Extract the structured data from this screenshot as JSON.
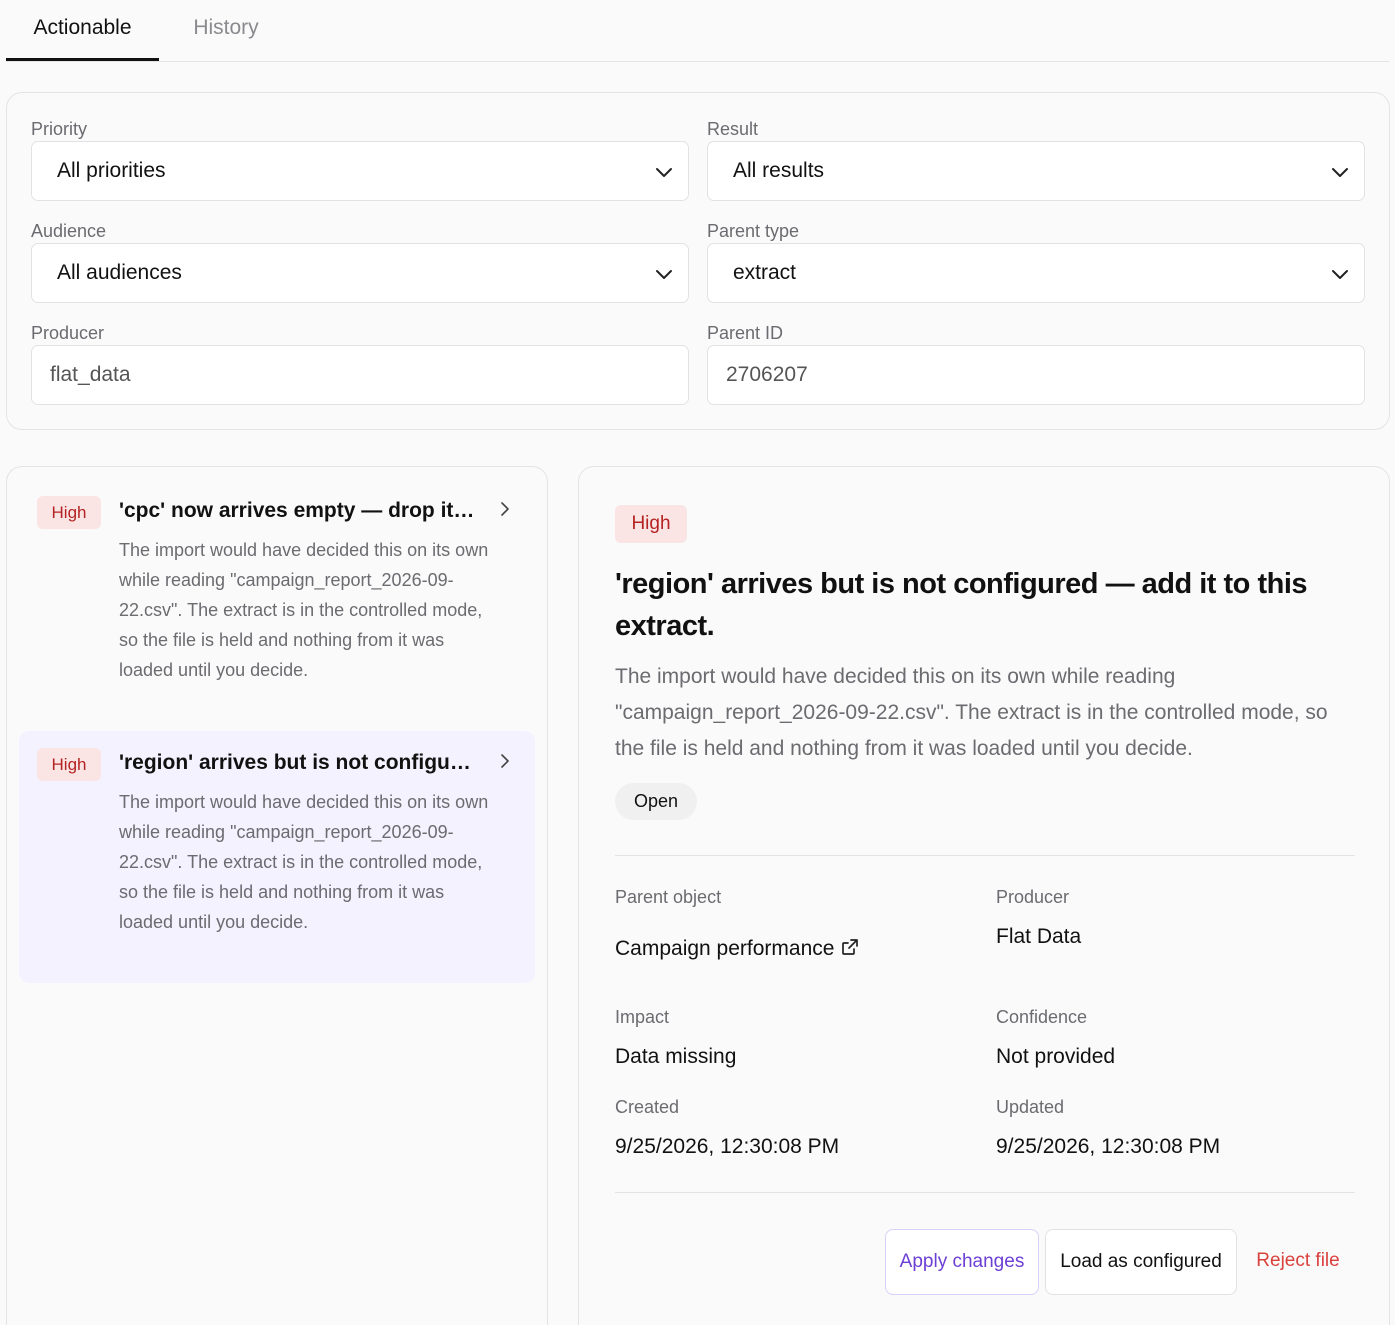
{
  "tabs": {
    "actionable": "Actionable",
    "history": "History"
  },
  "filters": {
    "priority": {
      "label": "Priority",
      "value": "All priorities"
    },
    "result": {
      "label": "Result",
      "value": "All results"
    },
    "audience": {
      "label": "Audience",
      "value": "All audiences"
    },
    "parent_type": {
      "label": "Parent type",
      "value": "extract"
    },
    "producer": {
      "label": "Producer",
      "value": "flat_data"
    },
    "parent_id": {
      "label": "Parent ID",
      "value": "2706207"
    }
  },
  "list": {
    "items": [
      {
        "priority": "High",
        "title": "'cpc' now arrives empty — drop it from this extract.",
        "description": "The import would have decided this on its own while reading \"campaign_report_2026-09-22.csv\". The extract is in the controlled mode, so the file is held and nothing from it was loaded until you decide."
      },
      {
        "priority": "High",
        "title": "'region' arrives but is not configured — add it to this extract.",
        "description": "The import would have decided this on its own while reading \"campaign_report_2026-09-22.csv\". The extract is in the controlled mode, so the file is held and nothing from it was loaded until you decide."
      }
    ]
  },
  "detail": {
    "priority": "High",
    "title": "'region' arrives but is not configured — add it to this extract.",
    "description": "The import would have decided this on its own while reading \"campaign_report_2026-09-22.csv\". The extract is in the controlled mode, so the file is held and nothing from it was loaded until you decide.",
    "status": "Open",
    "parent_object": {
      "label": "Parent object",
      "value": "Campaign performance"
    },
    "producer": {
      "label": "Producer",
      "value": "Flat Data"
    },
    "impact": {
      "label": "Impact",
      "value": "Data missing"
    },
    "confidence": {
      "label": "Confidence",
      "value": "Not provided"
    },
    "created": {
      "label": "Created",
      "value": "9/25/2026, 12:30:08 PM"
    },
    "updated": {
      "label": "Updated",
      "value": "9/25/2026, 12:30:08 PM"
    },
    "actions": {
      "apply": "Apply changes",
      "load": "Load as configured",
      "reject": "Reject file"
    }
  },
  "colors": {
    "accent": "#6d3fd6",
    "danger": "#d9413d",
    "badge_bg": "#fbe4e4",
    "badge_text": "#b42323",
    "selected_bg": "#f3f2fe"
  }
}
